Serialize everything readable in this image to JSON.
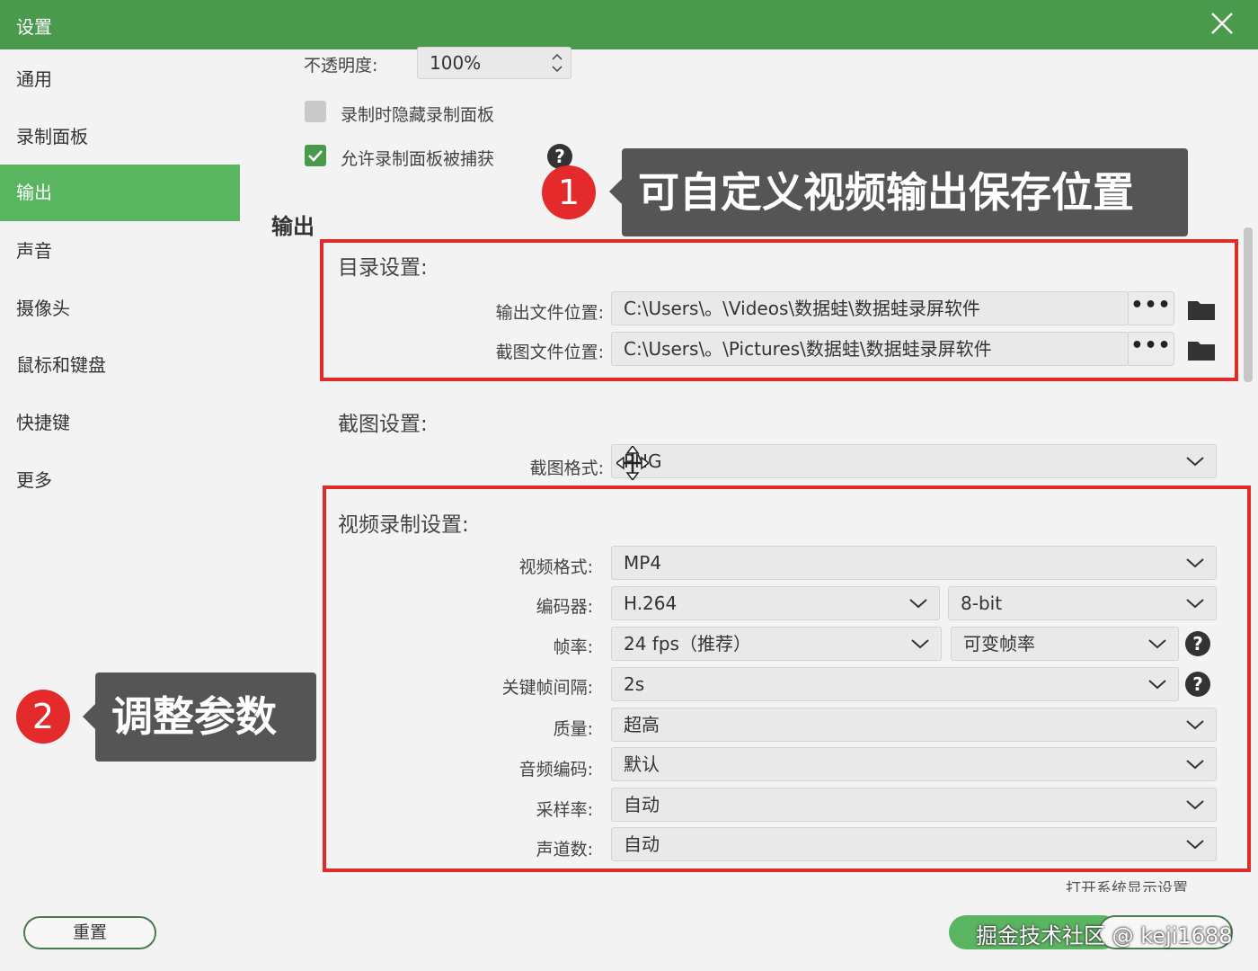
{
  "window": {
    "title": "设置",
    "close_icon": "close-icon"
  },
  "sidebar": {
    "items": [
      {
        "label": "通用",
        "active": false
      },
      {
        "label": "录制面板",
        "active": false
      },
      {
        "label": "输出",
        "active": true
      },
      {
        "label": "声音",
        "active": false
      },
      {
        "label": "摄像头",
        "active": false
      },
      {
        "label": "鼠标和键盘",
        "active": false
      },
      {
        "label": "快捷键",
        "active": false
      },
      {
        "label": "更多",
        "active": false
      }
    ]
  },
  "panel": {
    "opacity_label": "不透明度:",
    "opacity_value": "100%",
    "hide_panel_label": "录制时隐藏录制面板",
    "hide_panel_checked": false,
    "allow_capture_label": "允许录制面板被捕获",
    "allow_capture_checked": true,
    "help_icon": "question-icon"
  },
  "output": {
    "section_title": "输出",
    "directory": {
      "title": "目录设置:",
      "output_label": "输出文件位置:",
      "output_path": "C:\\Users\\。\\Videos\\数据蛙\\数据蛙录屏软件",
      "screenshot_label": "截图文件位置:",
      "screenshot_path": "C:\\Users\\。\\Pictures\\数据蛙\\数据蛙录屏软件",
      "browse_label": "•••"
    },
    "screenshot": {
      "title": "截图设置:",
      "format_label": "截图格式:",
      "format_value": "PNG"
    },
    "video": {
      "title": "视频录制设置:",
      "format_label": "视频格式:",
      "format_value": "MP4",
      "encoder_label": "编码器:",
      "encoder_value": "H.264",
      "bitdepth_value": "8-bit",
      "framerate_label": "帧率:",
      "framerate_value": "24 fps（推荐）",
      "framerate_mode_value": "可变帧率",
      "keyframe_label": "关键帧间隔:",
      "keyframe_value": "2s",
      "quality_label": "质量:",
      "quality_value": "超高",
      "audio_codec_label": "音频编码:",
      "audio_codec_value": "默认",
      "sample_rate_label": "采样率:",
      "sample_rate_value": "自动",
      "channels_label": "声道数:",
      "channels_value": "自动"
    },
    "display_link": "打开系统显示设置"
  },
  "annotations": {
    "badge_1": "1",
    "callout_1": "可自定义视频输出保存位置",
    "badge_2": "2",
    "callout_2": "调整参数",
    "highlight_color": "#e02b2b"
  },
  "footer": {
    "reset_label": "重置",
    "watermark": "掘金技术社区 @ keji1688"
  },
  "colors": {
    "brand_green": "#4a9a4e",
    "active_green": "#5ab560",
    "badge_red": "#e42a2a",
    "callout_gray": "#555555"
  }
}
